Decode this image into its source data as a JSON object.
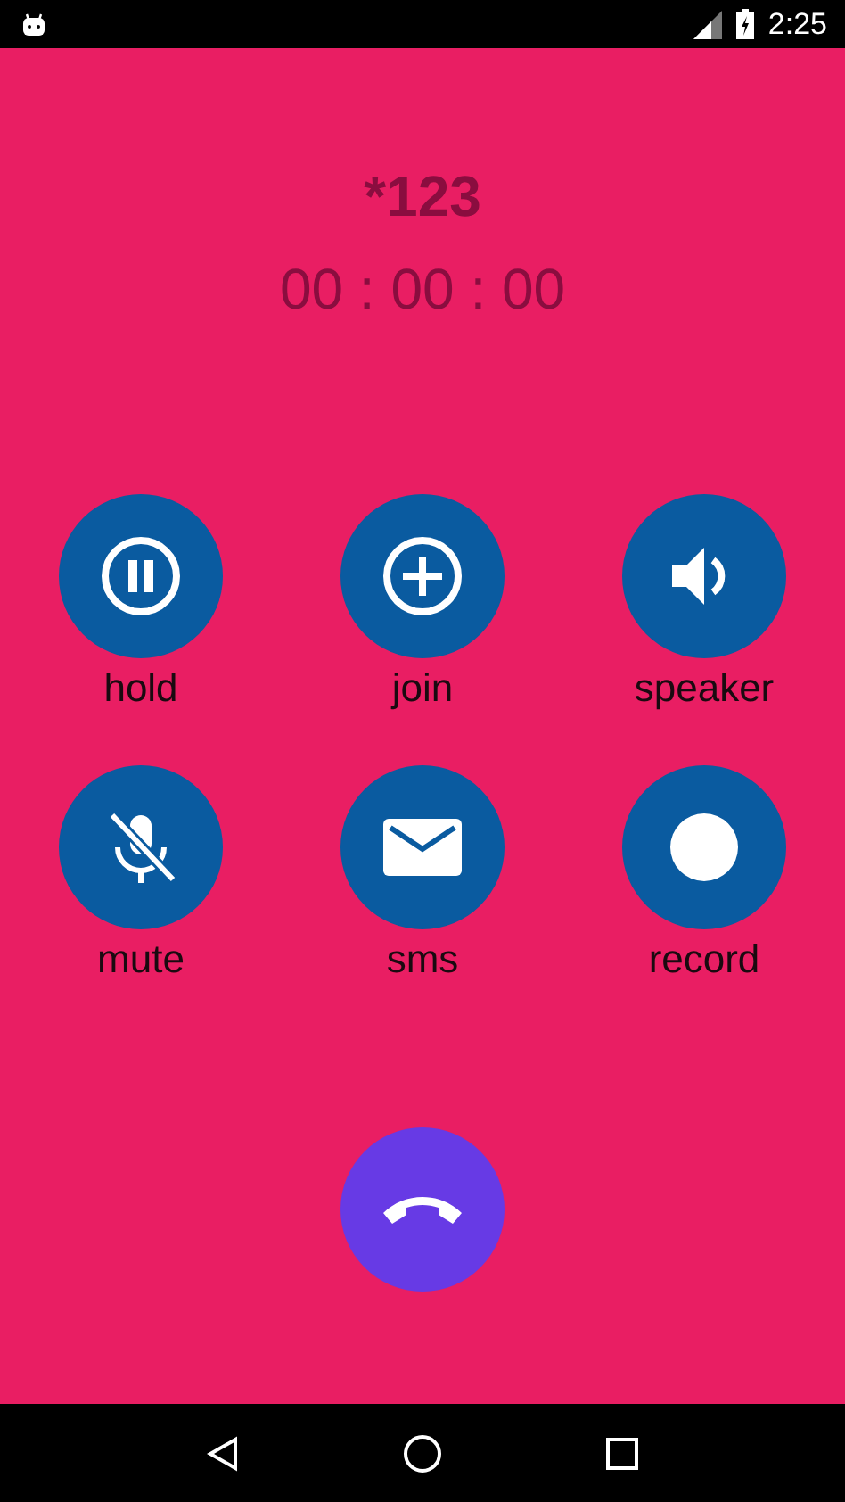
{
  "status_bar": {
    "time": "2:25"
  },
  "call": {
    "number": "*123",
    "timer": "00 : 00 : 00"
  },
  "actions": [
    {
      "label": "hold",
      "kind": "pause"
    },
    {
      "label": "join",
      "kind": "add"
    },
    {
      "label": "speaker",
      "kind": "speaker"
    },
    {
      "label": "mute",
      "kind": "mic-off"
    },
    {
      "label": "sms",
      "kind": "mail"
    },
    {
      "label": "record",
      "kind": "record"
    }
  ],
  "end_call": {
    "kind": "hang-up"
  }
}
